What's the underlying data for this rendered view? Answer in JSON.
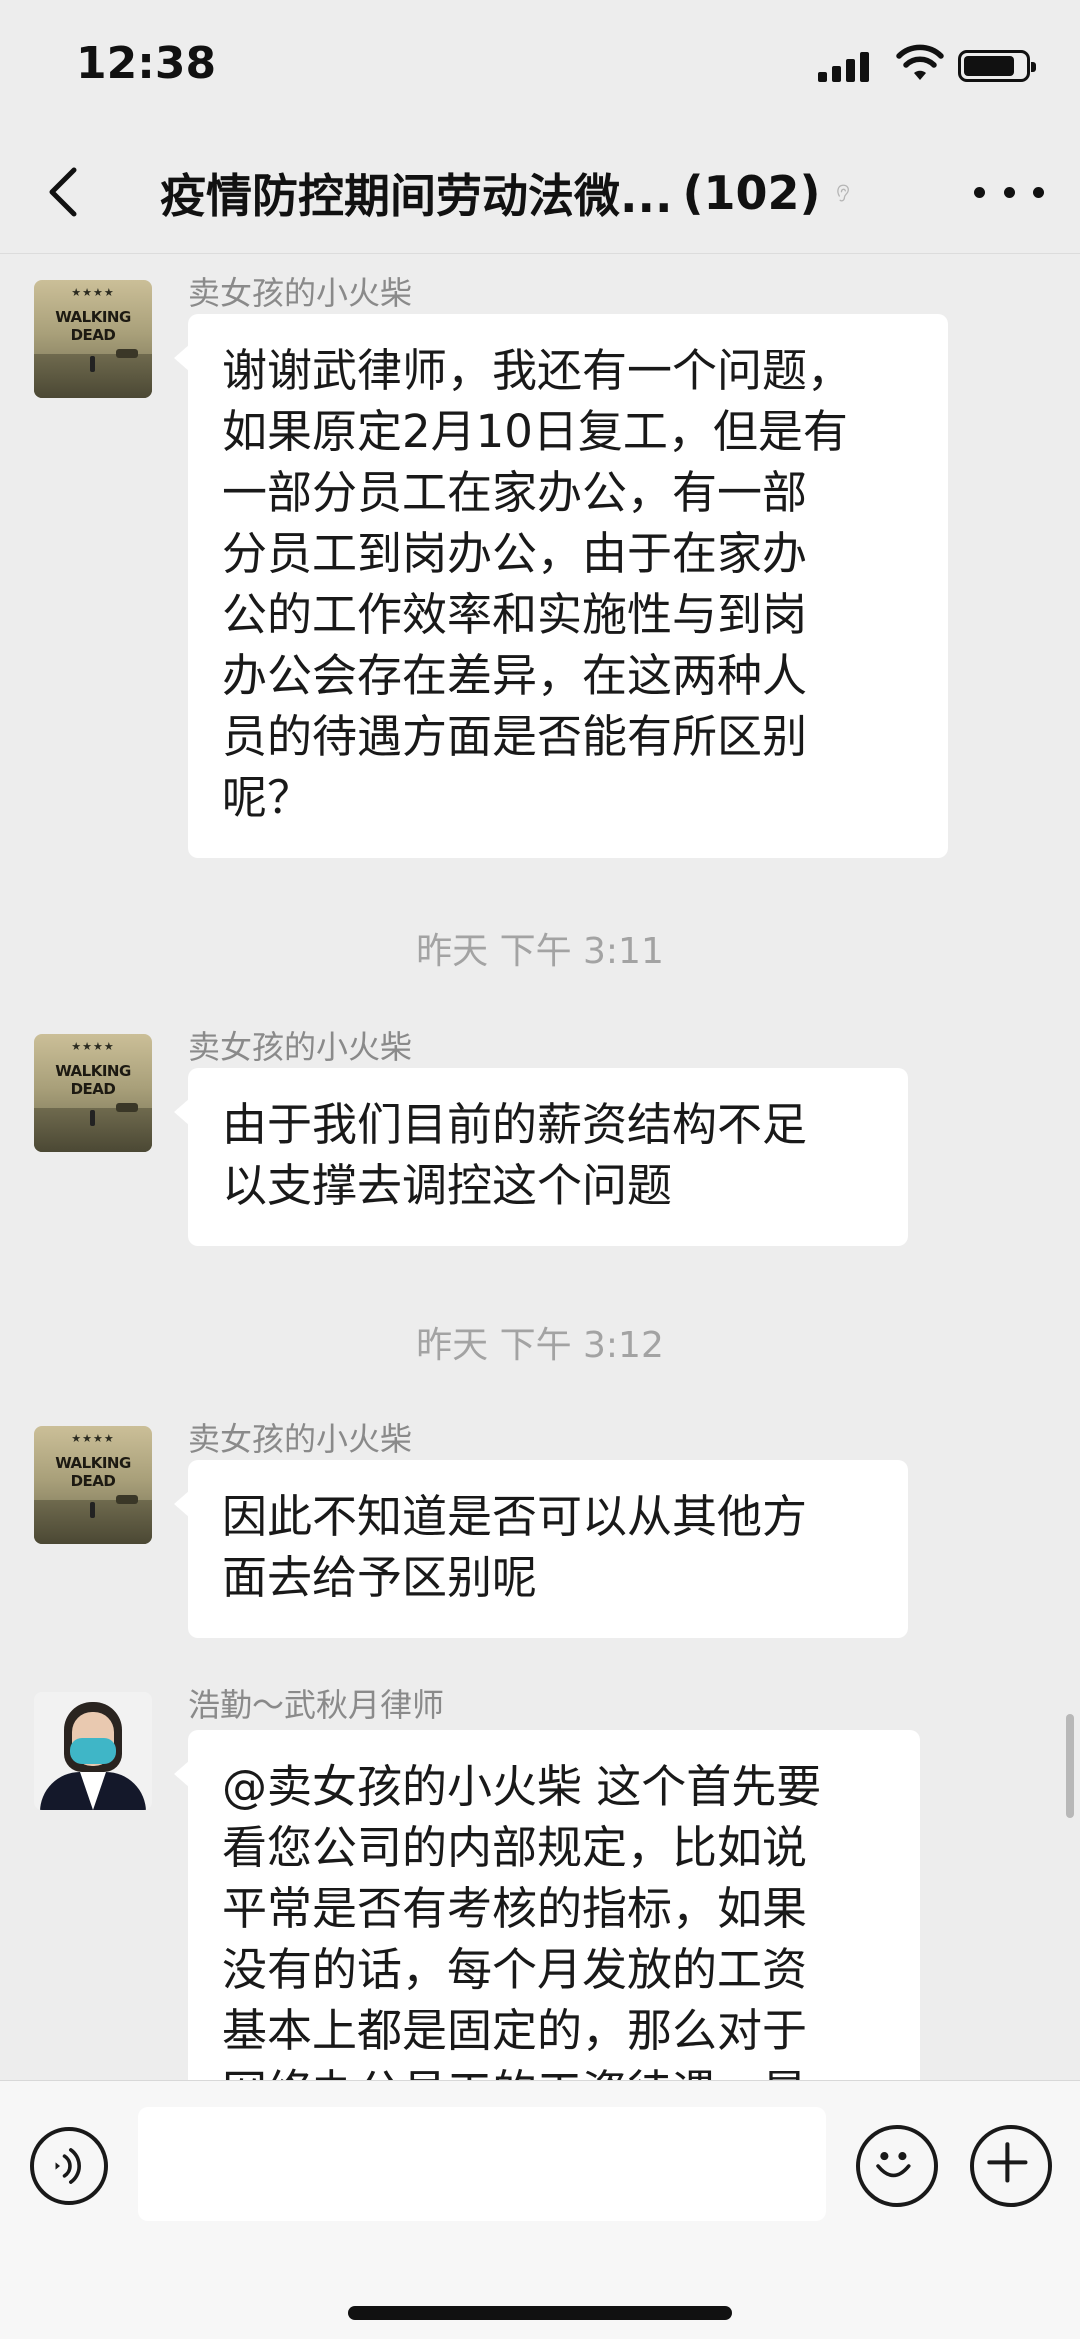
{
  "status_bar": {
    "time": "12:38"
  },
  "nav": {
    "title": "疫情防控期间劳动法微...",
    "member_count": "(102)"
  },
  "avatars": {
    "walking_dead": {
      "stars": "★★★★",
      "title": "WALKING DEAD"
    }
  },
  "messages": [
    {
      "sender": "卖女孩的小火柴",
      "lines": [
        "谢谢武律师，我还有一个问题，",
        "如果原定2月10日复工，但是有",
        "一部分员工在家办公，有一部",
        "分员工到岗办公，由于在家办",
        "公的工作效率和实施性与到岗",
        "办公会存在差异，在这两种人",
        "员的待遇方面是否能有所区别",
        "呢？"
      ]
    },
    {
      "timestamp": "昨天 下午 3:11"
    },
    {
      "sender": "卖女孩的小火柴",
      "lines": [
        "由于我们目前的薪资结构不足",
        "以支撑去调控这个问题"
      ]
    },
    {
      "timestamp": "昨天 下午 3:12"
    },
    {
      "sender": "卖女孩的小火柴",
      "lines": [
        "因此不知道是否可以从其他方",
        "面去给予区别呢"
      ]
    },
    {
      "sender": "浩勤～武秋月律师",
      "lines": [
        "@卖女孩的小火柴 这个首先要",
        "看您公司的内部规定，比如说",
        "平常是否有考核的指标，如果",
        "没有的话，每个月发放的工资",
        "基本上都是固定的，那么对于",
        "网络办公员工的工资待遇，是"
      ]
    }
  ],
  "input_bar": {
    "placeholder": ""
  },
  "icons": [
    "back-arrow-icon",
    "ear-icon",
    "more-icon",
    "voice-icon",
    "emoji-icon",
    "plus-icon",
    "signal-icon",
    "wifi-icon",
    "battery-icon"
  ]
}
